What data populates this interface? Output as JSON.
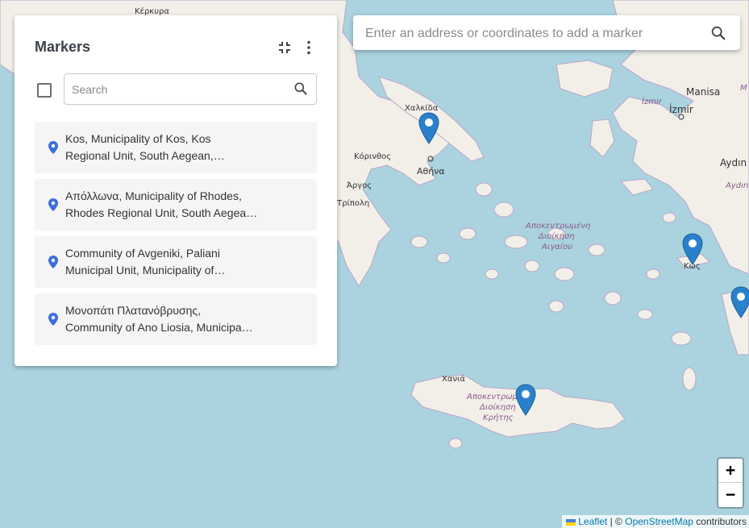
{
  "panel": {
    "title": "Markers",
    "search_placeholder": "Search",
    "items": [
      {
        "line1": "Kos, Municipality of Kos, Kos",
        "line2": "Regional Unit, South Aegean,…"
      },
      {
        "line1": "Απόλλωνα, Municipality of Rhodes,",
        "line2": "Rhodes Regional Unit, South Aegea…"
      },
      {
        "line1": "Community of Avgeniki, Paliani",
        "line2": "Municipal Unit, Municipality of…"
      },
      {
        "line1": "Μονοπάτι Πλατανόβρυσης,",
        "line2": "Community of Ano Liosia, Municipa…"
      }
    ]
  },
  "address_bar": {
    "placeholder": "Enter an address or coordinates to add a marker"
  },
  "zoom": {
    "in_label": "+",
    "out_label": "−"
  },
  "attribution": {
    "leaflet": "Leaflet",
    "sep": "| ©",
    "osm": "OpenStreetMap",
    "suffix": "contributors"
  },
  "map_labels": {
    "kerkyra": "Κέρκυρα",
    "chalkida": "Χαλκίδα",
    "korinthos": "Κόρινθος",
    "athina": "Αθήνα",
    "argos": "Άργος",
    "tripoli": "Τρίπολη",
    "izmir_it": "İzmir",
    "izmir": "İzmir",
    "manisa": "Manisa",
    "aydin": "Aydın",
    "aydin_it": "Aydın",
    "kos": "Κως",
    "chania": "Χανιά",
    "aegean_admin": [
      "Αποκεντρωμένη",
      "Διοίκηση",
      "Αιγαίου"
    ],
    "crete_admin": [
      "Αποκεντρωμένη",
      "Διοίκηση",
      "Κρήτης"
    ],
    "edge_m": "M"
  },
  "colors": {
    "sea": "#aad3df",
    "land": "#f2efe9",
    "marker": "#2a81cb",
    "pin_icon": "#3b6fd9"
  }
}
